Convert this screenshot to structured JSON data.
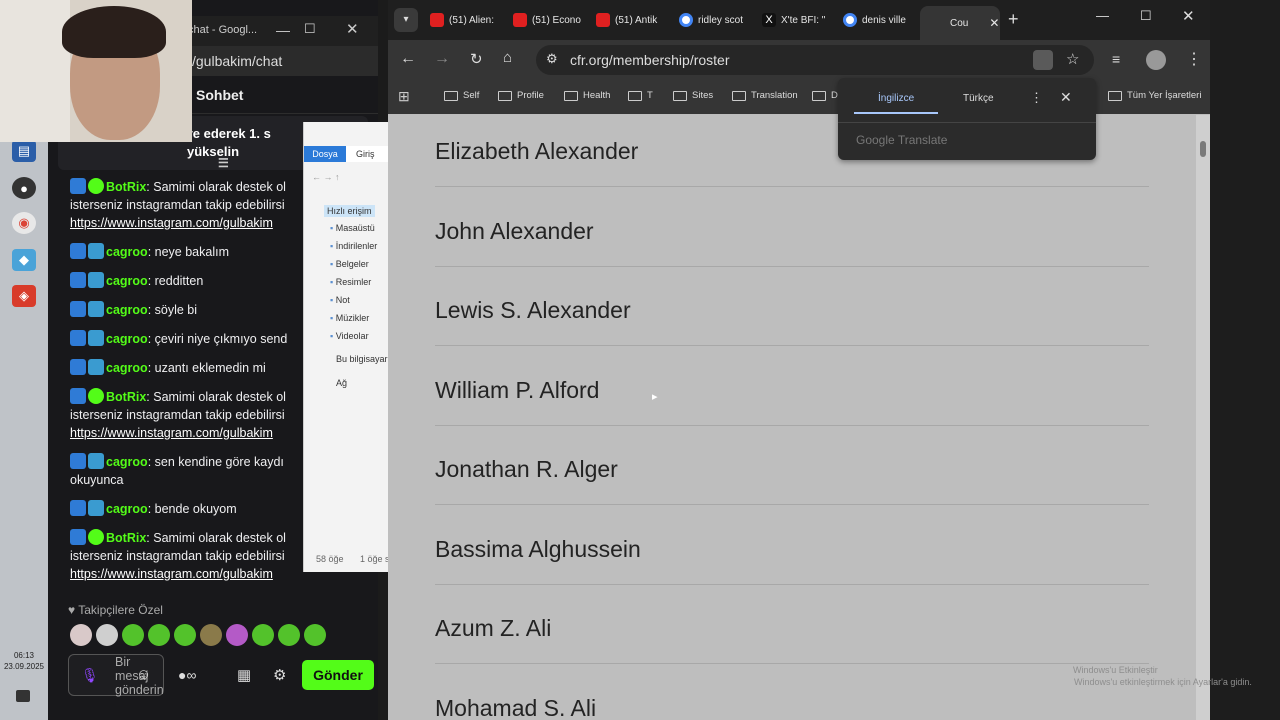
{
  "desktop": {
    "clock_time": "06:13",
    "clock_date": "23.09.2025"
  },
  "chat_window": {
    "title": "chat - Googl...",
    "url_fragment": "/gulbakim/chat",
    "header": "Sohbet",
    "pinned_line1": "k hediye ederek 1. s",
    "pinned_line2": "yükselin",
    "messages": [
      {
        "user": "BotRix",
        "text": ": Samimi olarak destek ol",
        "cont": "isterseniz instagramdan takip edebilirsi",
        "link": "https://www.instagram.com/gulbakim",
        "verified": true
      },
      {
        "user": "cagroo",
        "text": ": neye bakalım"
      },
      {
        "user": "cagroo",
        "text": ": redditten"
      },
      {
        "user": "cagroo",
        "text": ": söyle bi"
      },
      {
        "user": "cagroo",
        "text": ": çeviri niye çıkmıyo send"
      },
      {
        "user": "cagroo",
        "text": ": uzantı eklemedin mi"
      },
      {
        "user": "BotRix",
        "text": ": Samimi olarak destek ol",
        "cont": "isterseniz instagramdan takip edebilirsi",
        "link": "https://www.instagram.com/gulbakim",
        "verified": true
      },
      {
        "user": "cagroo",
        "text": ": sen kendine göre kaydı",
        "cont": "okuyunca"
      },
      {
        "user": "cagroo",
        "text": ": bende okuyom"
      },
      {
        "user": "BotRix",
        "text": ": Samimi olarak destek ol",
        "cont": "isterseniz instagramdan takip edebilirsi",
        "link": "https://www.instagram.com/gulbakim",
        "verified": true
      }
    ],
    "followers_label": "Takipçilere Özel",
    "input_placeholder": "Bir mesaj gönderin",
    "send_label": "Gönder"
  },
  "explorer": {
    "tab_file": "Dosya",
    "tab_home": "Giriş",
    "quick_access": "Hızlı erişim",
    "items": [
      "Masaüstü",
      "İndirilenler",
      "Belgeler",
      "Resimler",
      "Not",
      "Müzikler",
      "Videolar"
    ],
    "this_pc": "Bu bilgisayar",
    "network": "Ağ",
    "count": "58 öğe",
    "selected": "1 öğe s"
  },
  "browser": {
    "tabs": [
      {
        "label": "(51) Alien:",
        "icon": "youtube"
      },
      {
        "label": "(51) Econo",
        "icon": "youtube"
      },
      {
        "label": "(51) Antik",
        "icon": "youtube"
      },
      {
        "label": "ridley scot",
        "icon": "google"
      },
      {
        "label": "X'te BFI: \"",
        "icon": "x"
      },
      {
        "label": "denis ville",
        "icon": "google"
      },
      {
        "label": "Cou",
        "icon": "active"
      }
    ],
    "url": "cfr.org/membership/roster",
    "bookmarks": [
      "Self",
      "Profile",
      "Health",
      "T",
      "Sites",
      "Translation",
      "D"
    ],
    "all_bookmarks": "Tüm Yer İşaretleri",
    "names": [
      "Elizabeth Alexander",
      "John Alexander",
      "Lewis S. Alexander",
      "William P. Alford",
      "Jonathan R. Alger",
      "Bassima Alghussein",
      "Azum Z. Ali",
      "Mohamad S. Ali"
    ]
  },
  "translate_popup": {
    "lang_from": "İngilizce",
    "lang_to": "Türkçe",
    "brand": "Google Translate"
  },
  "watermark": {
    "line1": "Windows'u Etkinleştir",
    "line2": "Windows'u etkinleştirmek için Ayarlar'a gidin."
  }
}
